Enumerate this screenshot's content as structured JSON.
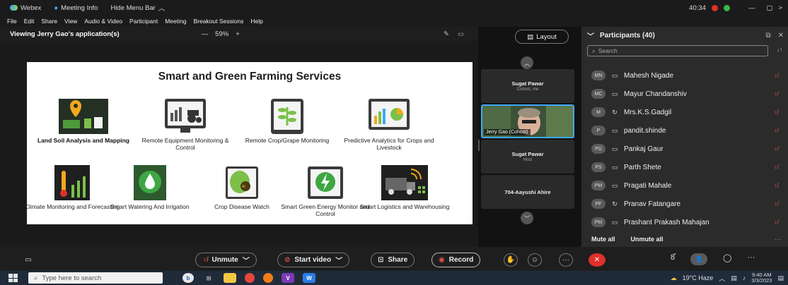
{
  "title_bar": {
    "app_name": "Webex",
    "meeting_info": "Meeting Info",
    "hide_menu_bar": "Hide Menu Bar",
    "timer": "40:34",
    "minimize_glyph": "—",
    "restore_glyph": "▢",
    "close_glyph": ">"
  },
  "menu": {
    "items": [
      "File",
      "Edit",
      "Share",
      "View",
      "Audio & Video",
      "Participant",
      "Meeting",
      "Breakout Sessions",
      "Help"
    ]
  },
  "share_bar": {
    "viewing": "Viewing Jerry Gao's application(s)",
    "zoom_out": "—",
    "zoom": "59%",
    "zoom_in": "+"
  },
  "slide": {
    "title": "Smart and Green Farming Services",
    "services": [
      "Land Soil Analysis and Mapping",
      "Remote Equipment Monitoring & Control",
      "Remote Crop/Grape Monitoring",
      "Predictive Analytics for Crops and Livestock",
      "Climate Monitoring and Forecasting",
      "Smart Watering And Irrigation",
      "Crop Disease Watch",
      "Smart Green Energy Monitor and Control",
      "Smart Logistics and Warehousing"
    ]
  },
  "video_strip": {
    "layout_label": "Layout",
    "tiles": [
      {
        "name": "Sugat Pawar",
        "sub": "Cohost, me"
      },
      {
        "name": "Jerry Gao (Cohost)",
        "sub": ""
      },
      {
        "name": "Sugat Pawar",
        "sub": "Host"
      },
      {
        "name": "704-Aayushi Ahire",
        "sub": ""
      }
    ]
  },
  "participants": {
    "header": "Participants (40)",
    "search_placeholder": "Search",
    "list": [
      {
        "initials": "MN",
        "name": "Mahesh Nigade"
      },
      {
        "initials": "MC",
        "name": "Mayur Chandanshiv"
      },
      {
        "initials": "M",
        "name": "Mrs.K.S.Gadgil"
      },
      {
        "initials": "P",
        "name": "pandit.shinde"
      },
      {
        "initials": "PG",
        "name": "Pankaj Gaur"
      },
      {
        "initials": "PS",
        "name": "Parth Shete"
      },
      {
        "initials": "PM",
        "name": "Pragati Mahale"
      },
      {
        "initials": "PF",
        "name": "Pranav Fatangare"
      },
      {
        "initials": "PM",
        "name": "Prashant Prakash Mahajan"
      }
    ],
    "mute_all": "Mute all",
    "unmute_all": "Unmute all"
  },
  "controls": {
    "unmute": "Unmute",
    "start_video": "Start video",
    "share": "Share",
    "record": "Record"
  },
  "taskbar": {
    "search_placeholder": "Type here to search",
    "weather": "19°C Haze",
    "time": "9:40 AM",
    "date": "3/3/2023"
  },
  "colors": {
    "accent_blue": "#3fa9f5",
    "record_red": "#e0574a",
    "end_call_red": "#e0302a",
    "panel_bg": "#2b2b2b"
  }
}
